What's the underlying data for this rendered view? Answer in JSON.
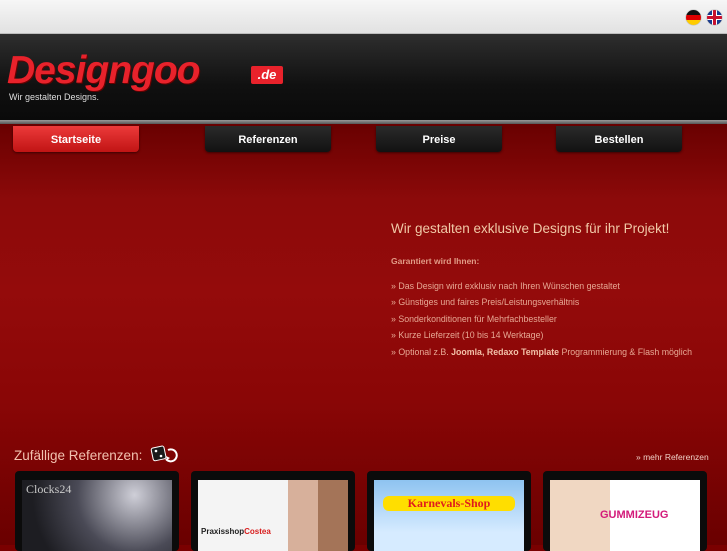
{
  "header": {
    "logo_main": "Designgoo",
    "logo_tld": ".de",
    "tagline": "Wir gestalten Designs."
  },
  "languages": [
    "de",
    "en"
  ],
  "nav": {
    "items": [
      {
        "label": "Startseite",
        "active": true
      },
      {
        "label": "Referenzen",
        "active": false
      },
      {
        "label": "Preise",
        "active": false
      },
      {
        "label": "Bestellen",
        "active": false
      }
    ]
  },
  "intro": {
    "headline": "Wir gestalten exklusive Designs für ihr Projekt!",
    "subhead": "Garantiert wird Ihnen:",
    "features": [
      "» Das Design wird exklusiv nach Ihren Wünschen gestaltet",
      "» Günstiges und faires Preis/Leistungsverhältnis",
      "» Sonderkonditionen für Mehrfachbesteller",
      "» Kurze Lieferzeit (10 bis 14 Werktage)"
    ],
    "last_feature": {
      "prefix": "» Optional z.B. ",
      "bold": "Joomla, Redaxo Template",
      "suffix": " Programmierung & Flash möglich"
    }
  },
  "references": {
    "title": "Zufällige Referenzen:",
    "more_link": "» mehr Referenzen",
    "items": [
      {
        "label": "Clocks24"
      },
      {
        "label_a": "Praxisshop",
        "label_b": "Costea"
      },
      {
        "label": "Karnevals-Shop"
      },
      {
        "label": "GUMMIZEUG"
      }
    ]
  },
  "colors": {
    "accent_red": "#e8222b",
    "background_red": "#8c0a0a",
    "header_dark": "#101010"
  }
}
